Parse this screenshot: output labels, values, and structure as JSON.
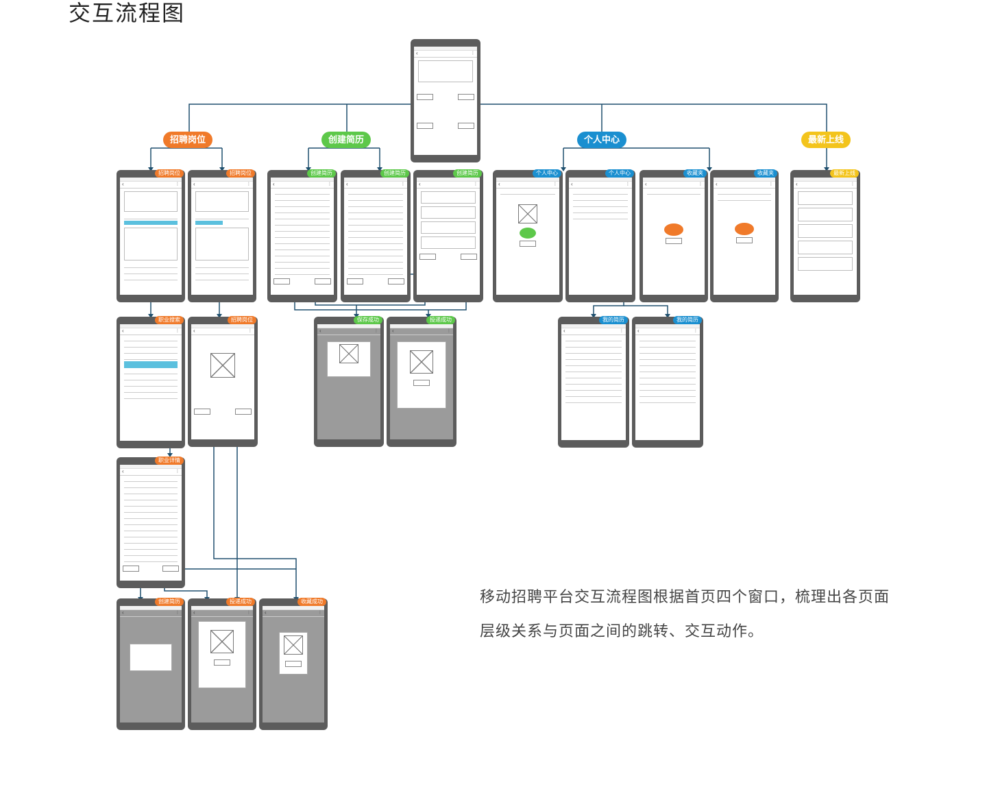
{
  "title": "交互流程图",
  "colors": {
    "orange": "#f07a2a",
    "green": "#5dc84a",
    "blue": "#1a8fd0",
    "yellow": "#f3c41c",
    "line": "#1e4f6e"
  },
  "categories": [
    {
      "key": "jobs",
      "label": "招聘岗位",
      "color": "orange"
    },
    {
      "key": "resume",
      "label": "创建简历",
      "color": "green"
    },
    {
      "key": "personal",
      "label": "个人中心",
      "color": "blue"
    },
    {
      "key": "latest",
      "label": "最新上线",
      "color": "yellow"
    }
  ],
  "tags": {
    "jobs": "招聘岗位",
    "resume": "创建简历",
    "personal": "个人中心",
    "favorites": "收藏夹",
    "latest": "最新上线",
    "job_search": "职业搜索",
    "save_ok": "保存成功",
    "apply_ok": "投递成功",
    "my_resume": "我的简历",
    "job_detail": "职业详情",
    "fav_ok": "收藏成功"
  },
  "description": "移动招聘平台交互流程图根据首页四个窗口，梳理出各页面层级关系与页面之间的跳转、交互动作。"
}
